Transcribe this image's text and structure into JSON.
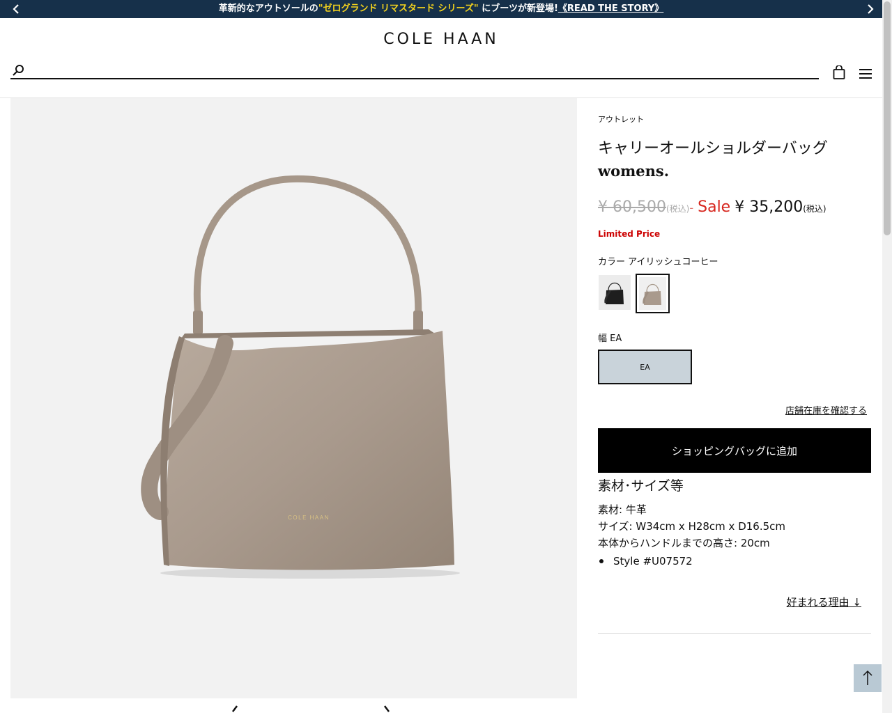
{
  "announcement": {
    "pre": "革新的なアウトソールの",
    "highlight": "\"ゼログランド リマスタード シリーズ\"",
    "post": " にブーツが新登場!",
    "link": "《READ THE STORY》",
    "prev_icon": "chevron-left-icon",
    "next_icon": "chevron-right-icon",
    "bg_color": "#16304a",
    "highlight_color": "#f4d31d"
  },
  "header": {
    "logo": "COLE HAAN",
    "search_placeholder": "",
    "search_icon": "search-icon",
    "bag_icon": "shopping-bag-icon",
    "menu_icon": "hamburger-menu-icon"
  },
  "product": {
    "category": "アウトレット",
    "title": "キャリーオールショルダーバッグ",
    "gender": "womens.",
    "price": {
      "original": "¥ 60,500",
      "original_tax": "(税込)",
      "separator": "-",
      "sale_label": "Sale",
      "current": "¥ 35,200",
      "current_tax": "(税込)"
    },
    "limited": "Limited Price",
    "color": {
      "label": "カラー",
      "value": "アイリッシュコーヒー",
      "swatches": [
        "black",
        "irish-coffee"
      ],
      "selected": "irish-coffee"
    },
    "width": {
      "label": "幅",
      "value": "EA",
      "option": "EA"
    },
    "store_stock_link": "店舗在庫を確認する",
    "add_to_bag": "ショッピングバッグに追加",
    "specs": {
      "heading": "素材･サイズ等",
      "material": "素材: 牛革",
      "size": "サイズ: W34cm x H28cm x D16.5cm",
      "handle_height": "本体からハンドルまでの高さ: 20cm",
      "style": "Style #U07572"
    },
    "why_link": "好まれる理由 ↓",
    "bag_logo": "COLE HAAN",
    "colors": {
      "sale": "#d7261e",
      "limited": "#cc0000",
      "bag": "#a99a8d",
      "selected_size_bg": "#c9d3da"
    }
  },
  "back_to_top_icon": "arrow-up-icon"
}
